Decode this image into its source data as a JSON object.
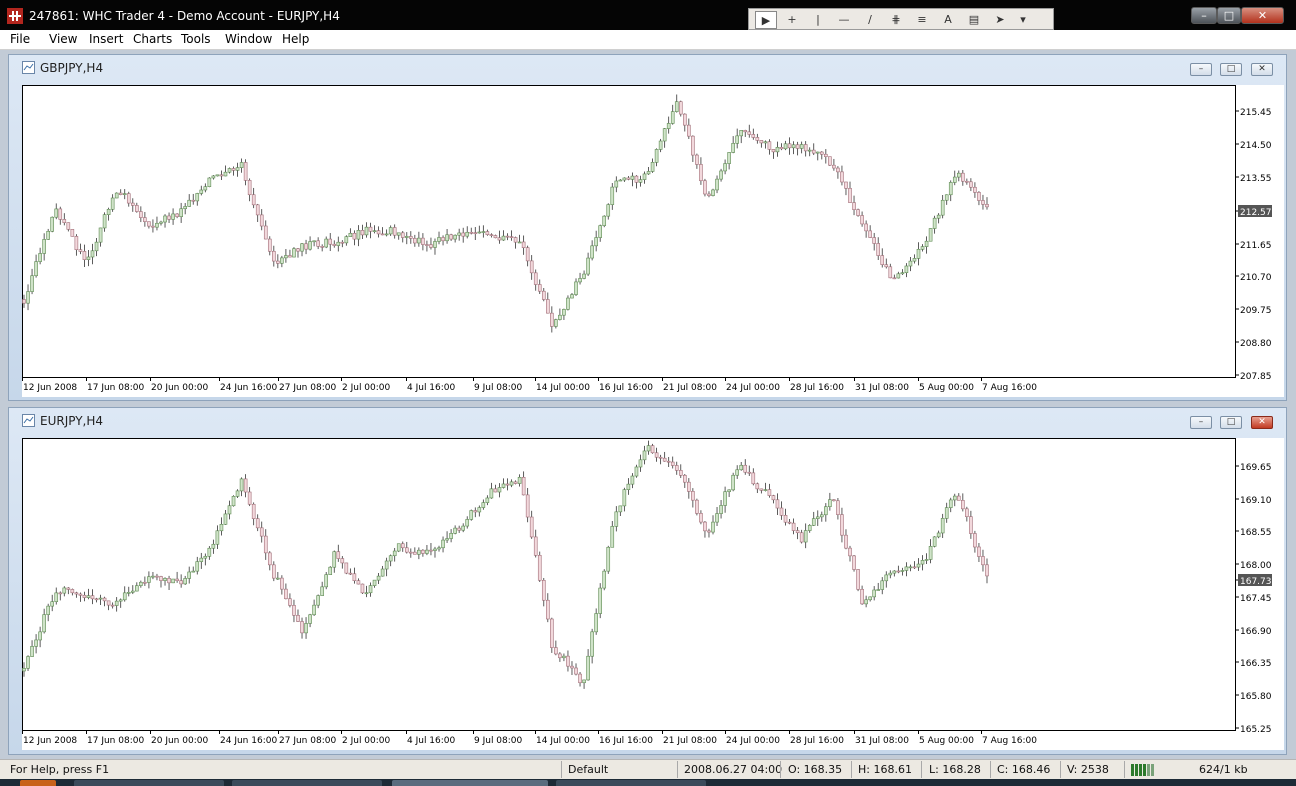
{
  "window": {
    "title": "247861: WHC Trader 4 - Demo Account - EURJPY,H4"
  },
  "menu": [
    "File",
    "View",
    "Insert",
    "Charts",
    "Tools",
    "Window",
    "Help"
  ],
  "toolbar_icons": [
    "cursor-icon",
    "crosshair-icon",
    "vertical-line-icon",
    "horizontal-line-icon",
    "trendline-icon",
    "channel-icon",
    "fibonacci-icon",
    "text-icon",
    "label-icon",
    "arrow-icon"
  ],
  "status": {
    "help": "For Help, press F1",
    "profile": "Default",
    "datetime": "2008.06.27 04:00",
    "open": "O: 168.35",
    "high": "H: 168.61",
    "low": "L: 168.28",
    "close": "C: 168.46",
    "volume": "V: 2538",
    "traffic": "624/1 kb"
  },
  "charts": [
    {
      "title": "GBPJPY,H4",
      "price_labels": [
        "215.45",
        "214.50",
        "213.55",
        "212.57",
        "211.65",
        "210.70",
        "209.75",
        "208.80",
        "207.85"
      ],
      "current_price": "212.57",
      "time_labels": [
        "12 Jun 2008",
        "17 Jun 08:00",
        "20 Jun 00:00",
        "24 Jun 16:00",
        "27 Jun 08:00",
        "2 Jul 00:00",
        "4 Jul 16:00",
        "9 Jul 08:00",
        "14 Jul 00:00",
        "16 Jul 16:00",
        "21 Jul 08:00",
        "24 Jul 00:00",
        "28 Jul 16:00",
        "31 Jul 08:00",
        "5 Aug 00:00",
        "7 Aug 16:00"
      ]
    },
    {
      "title": "EURJPY,H4",
      "price_labels": [
        "169.65",
        "169.10",
        "168.55",
        "168.00",
        "167.73",
        "167.45",
        "166.90",
        "166.35",
        "165.80",
        "165.25"
      ],
      "current_price": "167.73",
      "time_labels": [
        "12 Jun 2008",
        "17 Jun 08:00",
        "20 Jun 00:00",
        "24 Jun 16:00",
        "27 Jun 08:00",
        "2 Jul 00:00",
        "4 Jul 16:00",
        "9 Jul 08:00",
        "14 Jul 00:00",
        "16 Jul 16:00",
        "21 Jul 08:00",
        "24 Jul 00:00",
        "28 Jul 16:00",
        "31 Jul 08:00",
        "5 Aug 00:00",
        "7 Aug 16:00"
      ]
    }
  ],
  "chart_data": [
    {
      "type": "candlestick",
      "symbol": "GBPJPY,H4",
      "x": [
        "12 Jun",
        "14 Jun",
        "17 Jun",
        "19 Jun",
        "20 Jun",
        "22 Jun",
        "24 Jun",
        "25 Jun",
        "27 Jun",
        "29 Jun",
        "2 Jul",
        "3 Jul",
        "4 Jul",
        "6 Jul",
        "9 Jul",
        "11 Jul",
        "14 Jul",
        "15 Jul",
        "16 Jul",
        "18 Jul",
        "21 Jul",
        "22 Jul",
        "24 Jul",
        "26 Jul",
        "28 Jul",
        "30 Jul",
        "31 Jul",
        "3 Aug",
        "5 Aug",
        "6 Aug",
        "7 Aug",
        "8 Aug"
      ],
      "close": [
        210.0,
        212.5,
        211.0,
        213.1,
        212.0,
        212.4,
        213.3,
        213.7,
        211.0,
        211.5,
        211.6,
        211.9,
        211.9,
        211.5,
        211.8,
        211.8,
        211.6,
        209.3,
        210.7,
        213.2,
        213.4,
        215.5,
        212.8,
        214.7,
        214.2,
        214.3,
        213.8,
        212.0,
        210.5,
        211.6,
        213.5,
        212.57
      ],
      "ylim": [
        207.85,
        215.95
      ]
    },
    {
      "type": "candlestick",
      "symbol": "EURJPY,H4",
      "x": [
        "12 Jun",
        "14 Jun",
        "17 Jun",
        "19 Jun",
        "20 Jun",
        "22 Jun",
        "24 Jun",
        "25 Jun",
        "27 Jun",
        "29 Jun",
        "2 Jul",
        "3 Jul",
        "4 Jul",
        "6 Jul",
        "9 Jul",
        "11 Jul",
        "14 Jul",
        "15 Jul",
        "16 Jul",
        "18 Jul",
        "21 Jul",
        "22 Jul",
        "24 Jul",
        "26 Jul",
        "28 Jul",
        "30 Jul",
        "31 Jul",
        "3 Aug",
        "5 Aug",
        "6 Aug",
        "7 Aug",
        "8 Aug"
      ],
      "close": [
        166.2,
        167.5,
        167.4,
        167.3,
        167.7,
        167.6,
        168.2,
        169.3,
        167.8,
        166.8,
        168.1,
        167.4,
        168.2,
        168.1,
        168.5,
        169.1,
        169.3,
        166.6,
        166.0,
        168.7,
        169.8,
        169.5,
        168.4,
        169.5,
        169.0,
        168.3,
        169.0,
        167.3,
        167.8,
        168.0,
        169.1,
        167.73
      ],
      "ylim": [
        165.25,
        169.95
      ]
    }
  ]
}
